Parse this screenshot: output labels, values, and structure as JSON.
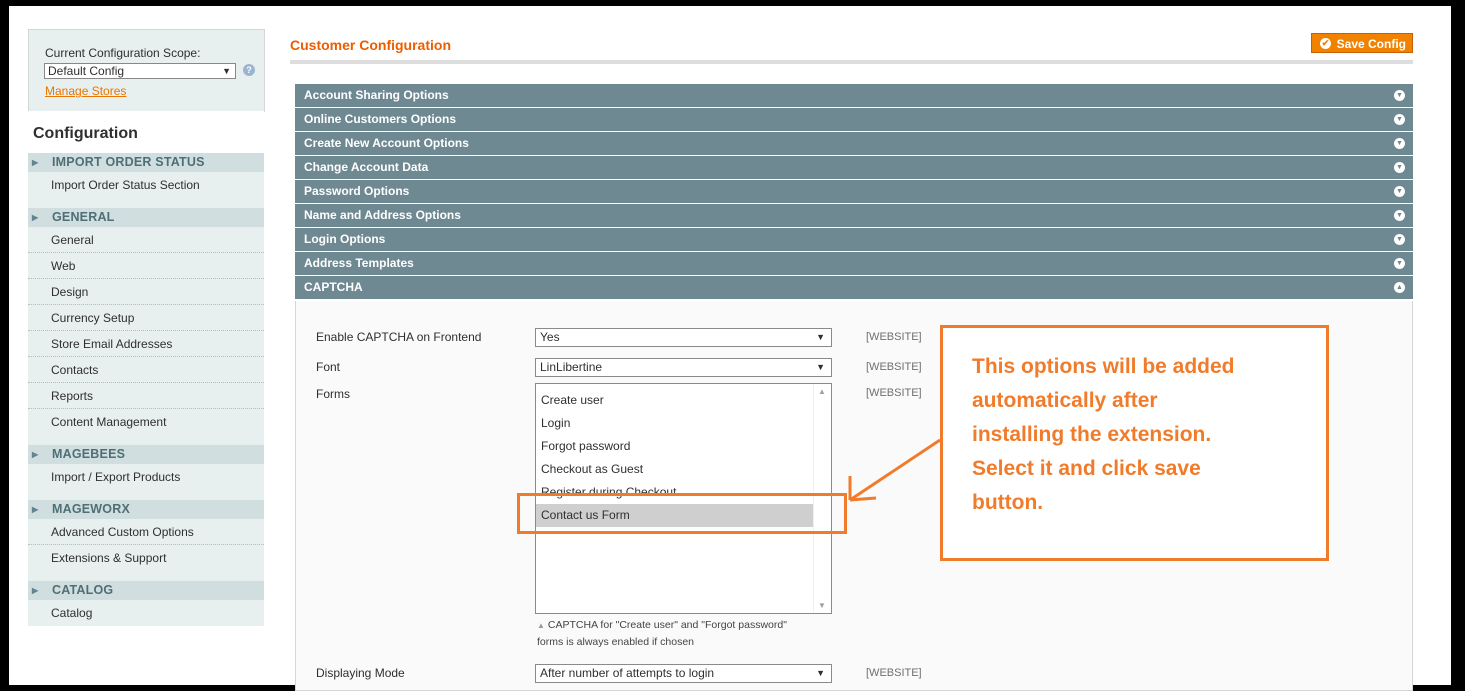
{
  "sidebar": {
    "scope_label": "Current Configuration Scope:",
    "scope_value": "Default Config",
    "manage_stores": "Manage Stores",
    "config_title": "Configuration",
    "groups": [
      {
        "title": "IMPORT ORDER STATUS",
        "items": [
          "Import Order Status Section"
        ]
      },
      {
        "title": "GENERAL",
        "items": [
          "General",
          "Web",
          "Design",
          "Currency Setup",
          "Store Email Addresses",
          "Contacts",
          "Reports",
          "Content Management"
        ]
      },
      {
        "title": "MAGEBEES",
        "items": [
          "Import / Export Products"
        ]
      },
      {
        "title": "MAGEWORX",
        "items": [
          "Advanced Custom Options",
          "Extensions & Support"
        ]
      },
      {
        "title": "CATALOG",
        "items": [
          "Catalog"
        ]
      }
    ]
  },
  "main": {
    "title": "Customer Configuration",
    "save_button": "Save Config",
    "sections": [
      "Account Sharing Options",
      "Online Customers Options",
      "Create New Account Options",
      "Change Account Data",
      "Password Options",
      "Name and Address Options",
      "Login Options",
      "Address Templates",
      "CAPTCHA"
    ],
    "captcha": {
      "enable_label": "Enable CAPTCHA on Frontend",
      "enable_value": "Yes",
      "font_label": "Font",
      "font_value": "LinLibertine",
      "forms_label": "Forms",
      "forms_options": [
        "Create user",
        "Login",
        "Forgot password",
        "Checkout as Guest",
        "Register during Checkout",
        "Contact us Form"
      ],
      "forms_selected": "Contact us Form",
      "note_line1": "CAPTCHA for \"Create user\" and \"Forgot password\"",
      "note_line2": "forms is always enabled if chosen",
      "mode_label": "Displaying Mode",
      "mode_value": "After number of attempts to login",
      "scope_tag": "[WEBSITE]"
    }
  },
  "annotation": {
    "callout_lines": [
      "This options will be added",
      "automatically after",
      "installing the extension.",
      "Select it and click save",
      "button."
    ],
    "color": "#f07c2b"
  }
}
